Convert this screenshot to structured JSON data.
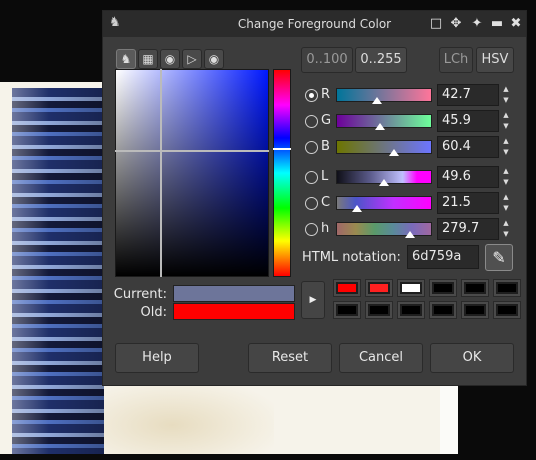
{
  "dialog": {
    "title": "Change Foreground Color",
    "logo_icon": "gimp-wilber-icon",
    "title_controls": [
      "minimize-icon",
      "move-icon",
      "pin-icon",
      "maximize-icon",
      "close-icon"
    ]
  },
  "selector_tabs": [
    {
      "icon": "gimp-selector-icon",
      "active": true
    },
    {
      "icon": "cmyk-selector-icon",
      "active": false
    },
    {
      "icon": "wheel-selector-icon",
      "active": false
    },
    {
      "icon": "triangle-selector-icon",
      "active": false
    },
    {
      "icon": "palette-selector-icon",
      "active": false
    }
  ],
  "range_toggle": {
    "option_a": "0..100",
    "option_b": "0..255",
    "selected": "0..255"
  },
  "model_toggle": {
    "option_a": "LCh",
    "option_b": "HSV",
    "selected": "HSV"
  },
  "channels": [
    {
      "label": "R",
      "value": "42.7",
      "checked": true,
      "marker": 0.427,
      "gradient": [
        "#00759a",
        "#ff759a"
      ]
    },
    {
      "label": "G",
      "value": "45.9",
      "checked": false,
      "marker": 0.459,
      "gradient": [
        "#6d009a",
        "#6dff9a"
      ]
    },
    {
      "label": "B",
      "value": "60.4",
      "checked": false,
      "marker": 0.604,
      "gradient": [
        "#6d7500",
        "#6d75ff"
      ]
    },
    {
      "label": "L",
      "value": "49.6",
      "checked": false,
      "marker": 0.496,
      "gradient": [
        "#000000",
        "#ff00ff"
      ]
    },
    {
      "label": "C",
      "value": "21.5",
      "checked": false,
      "marker": 0.215,
      "gradient": [
        "#7a7a7a",
        "#ff00ff"
      ]
    },
    {
      "label": "h",
      "value": "279.7",
      "checked": false,
      "marker": 0.777,
      "gradient": [
        "#a05050",
        "#5050c0"
      ]
    }
  ],
  "html_notation": {
    "label": "HTML notation:",
    "value": "6d759a",
    "picker_icon": "color-picker-icon"
  },
  "swatches": {
    "current_label": "Current:",
    "old_label": "Old:",
    "current_color": "#6d759a",
    "old_color": "#ff0000"
  },
  "history": {
    "arrow_icon": "triangle-right-icon",
    "colors": [
      "#ff0000",
      "#ff2020",
      "#ffffff",
      "#000000",
      "#000000",
      "#000000",
      "#000000",
      "#000000",
      "#000000",
      "#000000",
      "#000000",
      "#000000"
    ]
  },
  "buttons": {
    "help": "Help",
    "reset": "Reset",
    "cancel": "Cancel",
    "ok": "OK"
  }
}
